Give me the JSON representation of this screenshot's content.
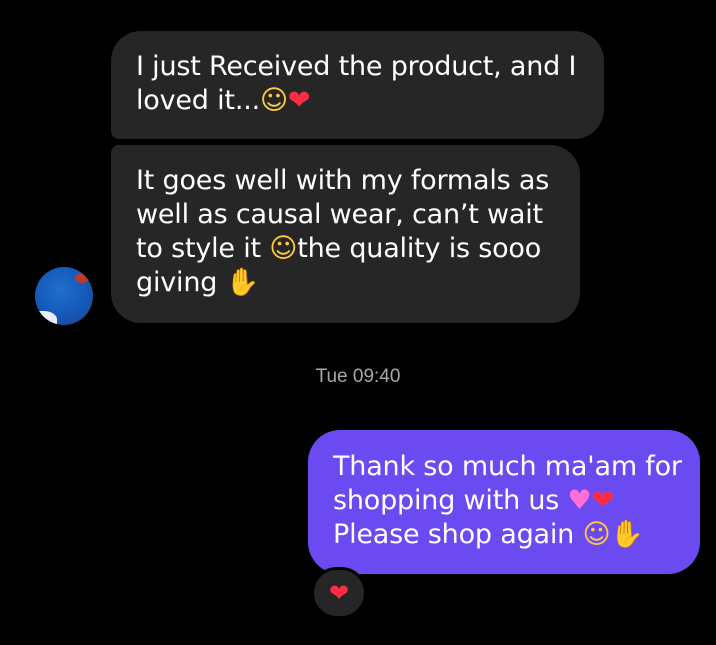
{
  "messages": {
    "received_1": {
      "text": "I just Received the product, and I loved it...",
      "emojis": [
        "smiling-face-with-hearts",
        "red-heart"
      ],
      "emoji_glyph_1": "☺",
      "emoji_glyph_2": "❤"
    },
    "received_2": {
      "line_a": "It goes well with my formals as well as causal wear, can’t wait to style it ",
      "emoji_1": "☺",
      "line_b": "the quality is sooo giving ",
      "emoji_2": "✋"
    },
    "sent_1": {
      "line_a": "Thank so much ma'am for shopping with us ",
      "emoji_1": "♥",
      "emoji_2": "❤",
      "line_b": "Please shop again ",
      "emoji_3": "☺",
      "emoji_4": "✋"
    }
  },
  "timestamp": "Tue 09:40",
  "reaction": {
    "emoji": "❤",
    "icon": "red-heart-icon"
  },
  "colors": {
    "background": "#000000",
    "received_bubble": "#262626",
    "sent_bubble": "#6c4af2",
    "timestamp_text": "#a8a8a8",
    "heart": "#ff2d43"
  }
}
